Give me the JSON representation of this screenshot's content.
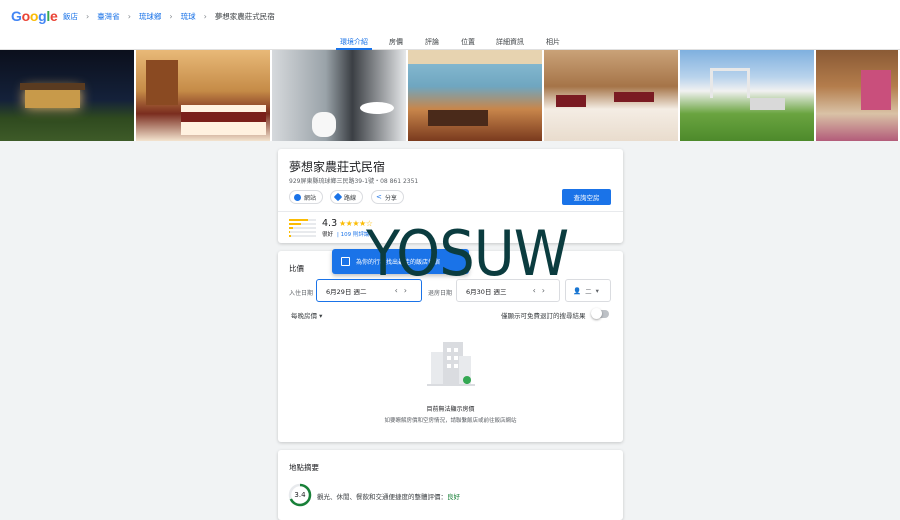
{
  "header": {
    "logo": "Google",
    "logo_colors": [
      "#4285f4",
      "#ea4335",
      "#fbbc05",
      "#4285f4",
      "#34a853",
      "#ea4335"
    ],
    "breadcrumbs": [
      "飯店",
      "臺灣省",
      "琉球鄉",
      "琉球",
      "夢想家農莊式民宿"
    ]
  },
  "tabs": [
    "環境介紹",
    "房價",
    "評論",
    "位置",
    "詳細資訊",
    "相片"
  ],
  "active_tab": "環境介紹",
  "gallery": {
    "photos": [
      "building-night-photo",
      "bedroom-red-photo",
      "bathroom-photo",
      "lounge-photo",
      "twin-bedroom-photo",
      "garden-swing-photo",
      "room-interior-photo"
    ]
  },
  "hotel": {
    "name": "夢想家農莊式民宿",
    "address": "929屏東縣琉球鄉三民路39-1號・08 861 2351",
    "chips": [
      "網站",
      "路線",
      "分享"
    ],
    "cta": "查詢空房",
    "rating": "4.3",
    "stars": "★★★★☆",
    "stars_value": 4.3,
    "rating_label": "很好",
    "reviews": "| 109 則評論"
  },
  "prices": {
    "title": "比價",
    "tooltip": "為你的行程找出最佳的飯店住宿",
    "checkin_label": "入住日期",
    "checkin_value": "6月29日 週二",
    "checkout_label": "退房日期",
    "checkout_value": "6月30日 週三",
    "guests_value": "二",
    "per_night": "每晚房價 ▾",
    "toggle_label": "僅顯示可免費退訂的搜尋結果",
    "empty_title": "目前無法顯示房價",
    "empty_sub": "如要瞭解房價和空房情況，請聯繫飯店或前往飯店網站"
  },
  "location": {
    "title": "地點摘要",
    "score": "3.4",
    "score_value": 3.4,
    "description": "觀光、休閒、餐飲和交通便捷度的整體評價：",
    "rating_word": "良好"
  },
  "watermark": "YOSUW"
}
